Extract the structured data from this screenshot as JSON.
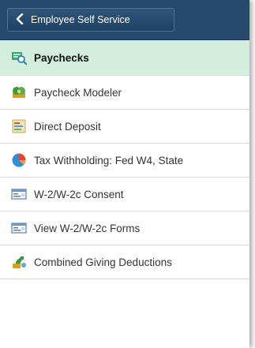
{
  "header": {
    "back_label": "Employee Self Service",
    "back_icon": "chevron-left-icon"
  },
  "menu": {
    "items": [
      {
        "label": "Paychecks",
        "icon": "paycheck-search-icon",
        "active": true
      },
      {
        "label": "Paycheck Modeler",
        "icon": "paycheck-modeler-icon",
        "active": false
      },
      {
        "label": "Direct Deposit",
        "icon": "direct-deposit-icon",
        "active": false
      },
      {
        "label": "Tax Withholding: Fed W4, State",
        "icon": "pie-chart-icon",
        "active": false
      },
      {
        "label": "W-2/W-2c Consent",
        "icon": "w2-form-icon",
        "active": false
      },
      {
        "label": "View W-2/W-2c Forms",
        "icon": "w2-form-icon",
        "active": false
      },
      {
        "label": "Combined Giving Deductions",
        "icon": "giving-icon",
        "active": false
      }
    ]
  },
  "colors": {
    "header_bg": "#24496c",
    "active_bg": "#d3eedd",
    "divider": "#d9d9d9"
  }
}
